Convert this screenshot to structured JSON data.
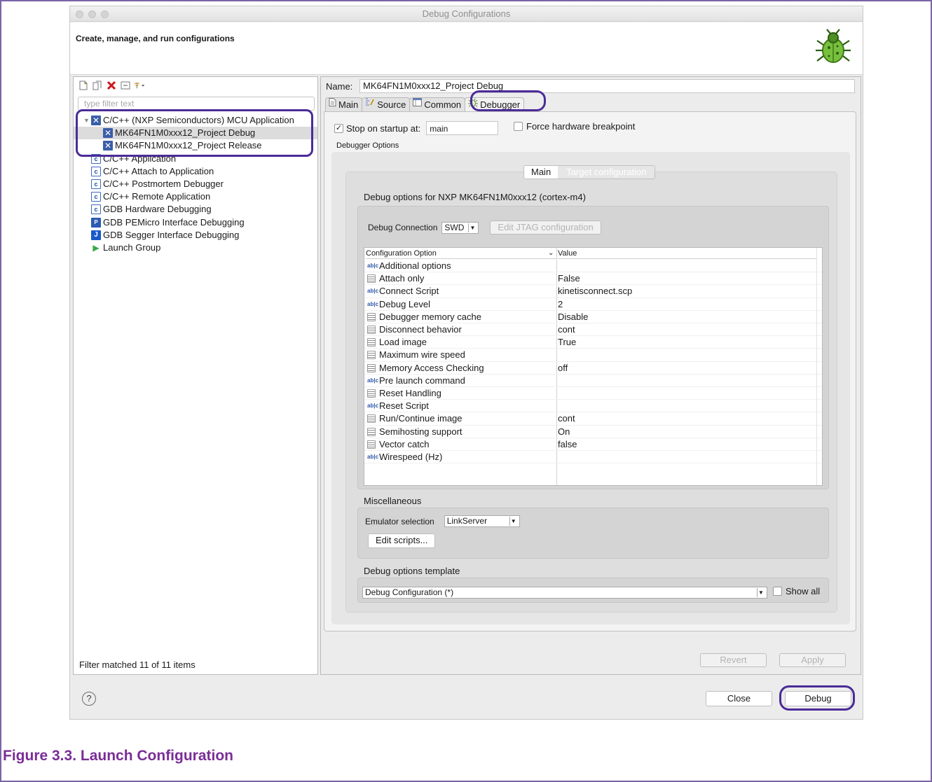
{
  "window": {
    "title": "Debug Configurations"
  },
  "header": {
    "text": "Create, manage, and run configurations"
  },
  "left_panel": {
    "filter_placeholder": "type filter text",
    "tree": [
      {
        "label": "C/C++ (NXP Semiconductors) MCU Application",
        "icon": "x",
        "level": 0,
        "expanded": true
      },
      {
        "label": "MK64FN1M0xxx12_Project Debug",
        "icon": "x",
        "level": 1,
        "selected": true
      },
      {
        "label": "MK64FN1M0xxx12_Project Release",
        "icon": "x",
        "level": 1
      },
      {
        "label": "C/C++ Application",
        "icon": "c",
        "level": 0
      },
      {
        "label": "C/C++ Attach to Application",
        "icon": "c",
        "level": 0
      },
      {
        "label": "C/C++ Postmortem Debugger",
        "icon": "c",
        "level": 0
      },
      {
        "label": "C/C++ Remote Application",
        "icon": "c",
        "level": 0
      },
      {
        "label": "GDB Hardware Debugging",
        "icon": "c",
        "level": 0
      },
      {
        "label": "GDB PEMicro Interface Debugging",
        "icon": "pe",
        "level": 0
      },
      {
        "label": "GDB Segger Interface Debugging",
        "icon": "j",
        "level": 0
      },
      {
        "label": "Launch Group",
        "icon": "play",
        "level": 0
      }
    ],
    "status": "Filter matched 11 of 11 items"
  },
  "right_panel": {
    "name_label": "Name:",
    "name_value": "MK64FN1M0xxx12_Project Debug",
    "tabs": [
      {
        "label": "Main",
        "icon": "document-icon"
      },
      {
        "label": "Source",
        "icon": "source-icon"
      },
      {
        "label": "Common",
        "icon": "common-icon"
      },
      {
        "label": "Debugger",
        "icon": "bug-small-icon",
        "active": true
      }
    ],
    "stop_label": "Stop on startup at:",
    "stop_checked": "✓",
    "stop_value": "main",
    "force_label": "Force hardware breakpoint",
    "debugger_options_label": "Debugger Options",
    "subtabs": {
      "main": "Main",
      "target": "Target configuration"
    },
    "debug_options_title": "Debug options for NXP MK64FN1M0xxx12 (cortex-m4)",
    "debug_connection_label": "Debug Connection",
    "debug_connection_value": "SWD",
    "edit_jtag_label": "Edit JTAG configuration",
    "table": {
      "col_option": "Configuration Option",
      "col_value": "Value",
      "rows": [
        {
          "option": "Additional options",
          "value": "",
          "icon": "abc"
        },
        {
          "option": "Attach only",
          "value": "False",
          "icon": "list"
        },
        {
          "option": "Connect Script",
          "value": "kinetisconnect.scp",
          "icon": "abc"
        },
        {
          "option": "Debug Level",
          "value": "2",
          "icon": "abc"
        },
        {
          "option": "Debugger memory cache",
          "value": "Disable",
          "icon": "list"
        },
        {
          "option": "Disconnect behavior",
          "value": "cont",
          "icon": "list"
        },
        {
          "option": "Load image",
          "value": "True",
          "icon": "list"
        },
        {
          "option": "Maximum wire speed",
          "value": "",
          "icon": "list"
        },
        {
          "option": "Memory Access Checking",
          "value": "off",
          "icon": "list"
        },
        {
          "option": "Pre launch command",
          "value": "",
          "icon": "abc"
        },
        {
          "option": "Reset Handling",
          "value": "",
          "icon": "list"
        },
        {
          "option": "Reset Script",
          "value": "",
          "icon": "abc"
        },
        {
          "option": "Run/Continue image",
          "value": "cont",
          "icon": "list"
        },
        {
          "option": "Semihosting support",
          "value": "On",
          "icon": "list"
        },
        {
          "option": "Vector catch",
          "value": "false",
          "icon": "list"
        },
        {
          "option": "Wirespeed (Hz)",
          "value": "",
          "icon": "abc"
        }
      ]
    },
    "misc_title": "Miscellaneous",
    "emulator_label": "Emulator selection",
    "emulator_value": "LinkServer",
    "edit_scripts_label": "Edit scripts...",
    "template_title": "Debug options template",
    "template_value": "Debug Configuration (*)",
    "show_all_label": "Show all",
    "revert_label": "Revert",
    "apply_label": "Apply"
  },
  "footer": {
    "help": "?",
    "close_label": "Close",
    "debug_label": "Debug"
  },
  "caption": "Figure 3.3. Launch Configuration",
  "colors": {
    "highlight": "#4b2b98",
    "caption": "#7a2d97"
  }
}
